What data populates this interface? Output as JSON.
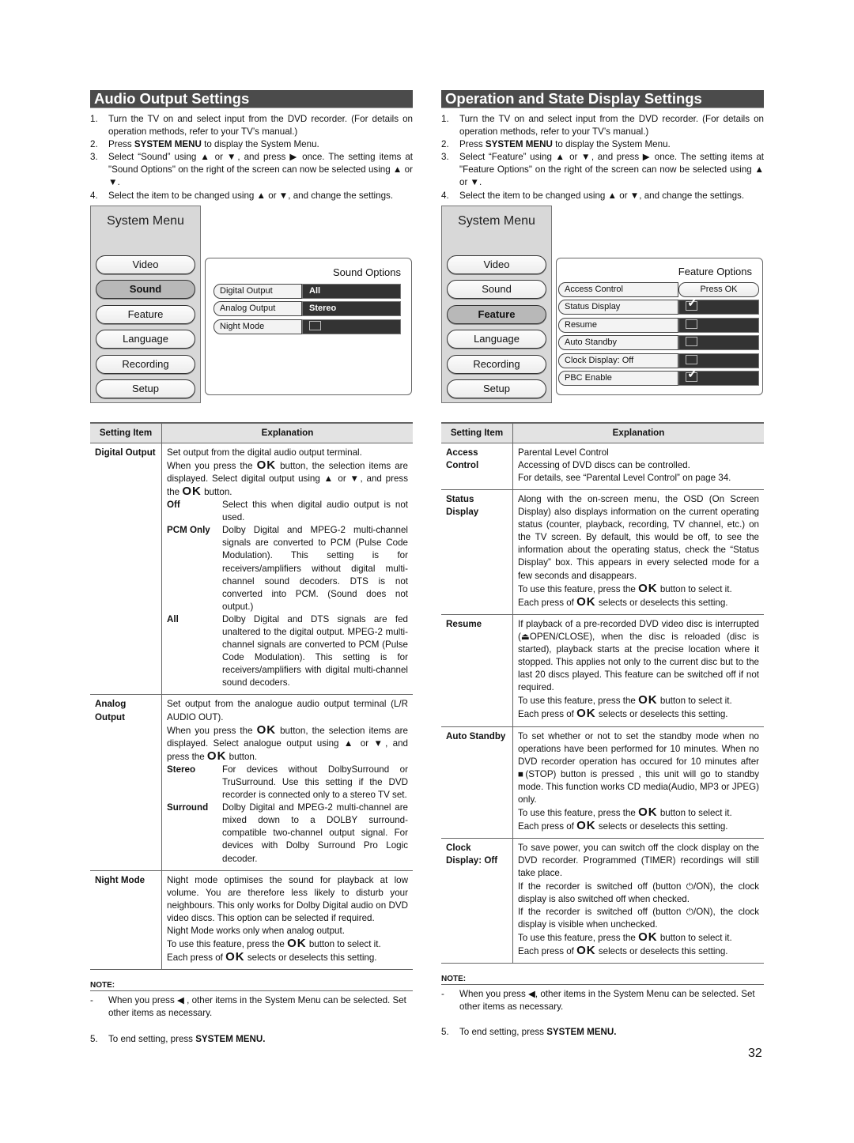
{
  "page_number": "32",
  "left": {
    "title": "Audio Output Settings",
    "steps": [
      {
        "num": "1.",
        "text": "Turn the TV on and select input from the DVD recorder. (For details on operation methods, refer to your TV’s manual.)"
      },
      {
        "num": "2.",
        "pre": "Press ",
        "bold": "SYSTEM MENU",
        "post": "  to display the System Menu."
      },
      {
        "num": "3.",
        "text": "Select “Sound” using ▲ or ▼, and press ▶ once. The setting items at \"Sound Options\" on the right of the screen can now be selected using ▲ or ▼."
      },
      {
        "num": "4.",
        "text": "Select the item to be changed using ▲ or ▼, and change the settings."
      }
    ],
    "menu": {
      "title": "System Menu",
      "items": [
        "Video",
        "Sound",
        "Feature",
        "Language",
        "Recording",
        "Setup"
      ],
      "active": "Sound"
    },
    "options": {
      "title": "Sound Options",
      "rows": [
        {
          "label": "Digital Output",
          "value": "All"
        },
        {
          "label": "Analog Output",
          "value": "Stereo"
        },
        {
          "label": "Night Mode",
          "checked": false
        }
      ]
    },
    "table": {
      "headers": [
        "Setting Item",
        "Explanation"
      ],
      "rows": [
        {
          "item": "Digital Output",
          "lines": [
            "Set output from the digital audio output terminal.",
            "When you press the OK button, the selection items are displayed. Select digital output using ▲ or ▼, and press the OK button."
          ],
          "options": [
            {
              "k": "Off",
              "v": "Select this when digital audio output is not used."
            },
            {
              "k": "PCM Only",
              "v": "Dolby Digital and MPEG-2 multi-channel signals are converted to PCM (Pulse Code Modulation). This setting is for receivers/amplifiers without digital multi-channel sound decoders. DTS is not converted into PCM. (Sound does not output.)"
            },
            {
              "k": "All",
              "v": "Dolby Digital and DTS signals are fed unaltered to the digital output. MPEG-2 multi-channel signals are converted to PCM (Pulse Code Modulation). This setting is for receivers/amplifiers with digital multi-channel sound decoders."
            }
          ]
        },
        {
          "item": "Analog Output",
          "lines": [
            "Set output from the analogue audio output terminal (L/R AUDIO OUT).",
            "When you press the OK button, the selection items are displayed. Select analogue output using ▲ or ▼, and press the OK button."
          ],
          "options": [
            {
              "k": "Stereo",
              "v": "For devices without DolbySurround or TruSurround. Use this setting if the DVD recorder is connected only to a stereo TV set."
            },
            {
              "k": "Surround",
              "v": "Dolby Digital and MPEG-2 multi-channel are mixed down to a DOLBY surround-compatible two-channel output signal. For devices with Dolby Surround Pro Logic decoder."
            }
          ]
        },
        {
          "item": "Night Mode",
          "lines": [
            "Night mode optimises the sound for playback at low volume. You are therefore less likely to disturb your neighbours. This only works for Dolby Digital audio on DVD video discs. This option can be selected if required.",
            "Night Mode works only when analog output.",
            "To use this feature, press the OK button to select it.",
            "Each press of OK selects or deselects this setting."
          ]
        }
      ]
    },
    "note": {
      "heading": "NOTE:",
      "dash": "-",
      "text": "When you press ◀ , other items in the System Menu can be selected. Set other items as necessary."
    },
    "end_step": {
      "num": "5.",
      "pre": "To end setting, press ",
      "bold": "SYSTEM MENU."
    }
  },
  "right": {
    "title": "Operation and State Display Settings",
    "steps": [
      {
        "num": "1.",
        "text": "Turn the TV on and select input from the DVD recorder. (For details on operation methods, refer to your TV’s manual.)"
      },
      {
        "num": "2.",
        "pre": "Press ",
        "bold": "SYSTEM MENU",
        "post": "  to display the System Menu."
      },
      {
        "num": "3.",
        "text": "Select “Feature” using ▲ or ▼, and press ▶ once. The setting items at \"Feature Options\" on the right of the screen can now be selected using ▲ or ▼."
      },
      {
        "num": "4.",
        "text": "Select the item to be changed using ▲ or ▼, and change the settings."
      }
    ],
    "menu": {
      "title": "System Menu",
      "items": [
        "Video",
        "Sound",
        "Feature",
        "Language",
        "Recording",
        "Setup"
      ],
      "active": "Feature"
    },
    "options": {
      "title": "Feature Options",
      "rows": [
        {
          "label": "Access Control",
          "value": "Press OK"
        },
        {
          "label": "Status Display",
          "checked": true
        },
        {
          "label": "Resume",
          "checked": false
        },
        {
          "label": "Auto Standby",
          "checked": false
        },
        {
          "label": "Clock Display: Off",
          "checked": false
        },
        {
          "label": "PBC Enable",
          "checked": true
        }
      ]
    },
    "table": {
      "headers": [
        "Setting Item",
        "Explanation"
      ],
      "rows": [
        {
          "item": "Access Control",
          "lines": [
            "Parental Level Control",
            "Accessing of DVD discs can be controlled.",
            "For details, see “Parental Level Control” on page 34."
          ]
        },
        {
          "item": "Status Display",
          "lines": [
            "Along with the on-screen menu, the OSD (On Screen Display) also displays information on the current operating status (counter, playback, recording, TV channel, etc.) on the TV screen. By default, this would be off, to see the information about the operating status, check the “Status Display” box. This appears in every selected mode for a few seconds and disappears.",
            "To use this feature, press the OK button to select it.",
            "Each press of OK selects or deselects this setting."
          ]
        },
        {
          "item": "Resume",
          "lines": [
            "If playback of a pre-recorded DVD video disc is interrupted (⏏OPEN/CLOSE), when the disc is reloaded (disc is started), playback starts at the precise location where it stopped. This applies not only to the current disc but to the last 20 discs played. This feature can be switched off if not required.",
            "To use this feature, press the OK button to select it.",
            "Each press of OK selects or deselects this setting."
          ]
        },
        {
          "item": "Auto Standby",
          "lines": [
            "To set whether or not to set the standby mode when no operations have been performed for 10 minutes. When no DVD recorder operation has occured for 10 minutes after ■(STOP) button is pressed , this unit will  go to standby mode. This function works CD media(Audio, MP3 or JPEG) only.",
            "To use this feature, press the OK button to select it.",
            "Each press of OK selects or deselects this setting."
          ]
        },
        {
          "item": "Clock Display: Off",
          "lines": [
            "To save power, you can switch off the clock display on the DVD recorder. Programmed (TIMER) recordings will still take place.",
            "If the recorder is switched off (button ⏻/ON), the clock display is also switched off when checked.",
            "If the recorder is switched off (button ⏻/ON), the clock display is visible when unchecked.",
            "To use this feature, press the OK button to select it.",
            "Each press of OK selects or deselects this setting."
          ]
        }
      ]
    },
    "note": {
      "heading": "NOTE:",
      "dash": "-",
      "text": "When you press ◀, other items in the System Menu can be selected. Set other items as necessary."
    },
    "end_step": {
      "num": "5.",
      "pre": "To end setting, press ",
      "bold": "SYSTEM MENU."
    }
  }
}
